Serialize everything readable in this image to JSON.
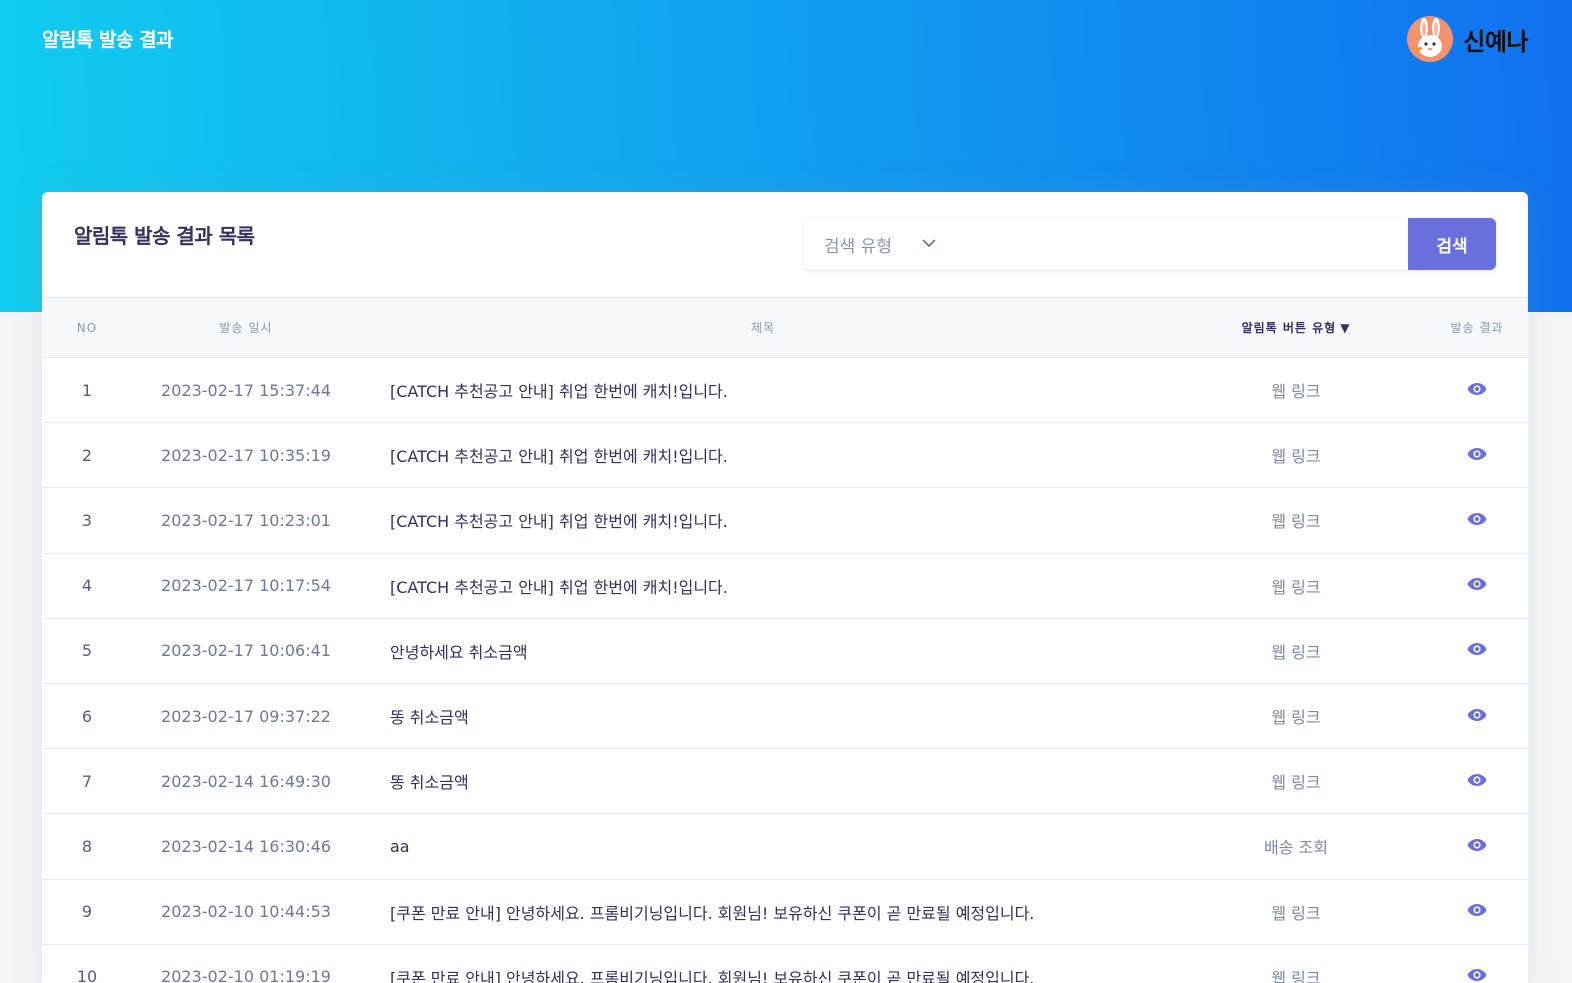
{
  "header": {
    "brand": "알림톡 발송 결과",
    "user_name": "신예나"
  },
  "card": {
    "title": "알림톡 발송 결과 목록",
    "search": {
      "select_placeholder": "검색 유형",
      "button_label": "검색"
    }
  },
  "table": {
    "columns": {
      "no": "NO",
      "date": "발송 일시",
      "subject": "제목",
      "button_type": "알림톡 버튼 유형",
      "result": "발송 결과"
    },
    "rows": [
      {
        "no": "1",
        "date": "2023-02-17 15:37:44",
        "subject": "[CATCH 추천공고 안내] 취업 한번에 캐치!입니다.",
        "button_type": "웹 링크"
      },
      {
        "no": "2",
        "date": "2023-02-17 10:35:19",
        "subject": "[CATCH 추천공고 안내] 취업 한번에 캐치!입니다.",
        "button_type": "웹 링크"
      },
      {
        "no": "3",
        "date": "2023-02-17 10:23:01",
        "subject": "[CATCH 추천공고 안내] 취업 한번에 캐치!입니다.",
        "button_type": "웹 링크"
      },
      {
        "no": "4",
        "date": "2023-02-17 10:17:54",
        "subject": "[CATCH 추천공고 안내] 취업 한번에 캐치!입니다.",
        "button_type": "웹 링크"
      },
      {
        "no": "5",
        "date": "2023-02-17 10:06:41",
        "subject": "안녕하세요 취소금액",
        "button_type": "웹 링크"
      },
      {
        "no": "6",
        "date": "2023-02-17 09:37:22",
        "subject": "똥 취소금액",
        "button_type": "웹 링크"
      },
      {
        "no": "7",
        "date": "2023-02-14 16:49:30",
        "subject": "똥 취소금액",
        "button_type": "웹 링크"
      },
      {
        "no": "8",
        "date": "2023-02-14 16:30:46",
        "subject": "aa",
        "button_type": "배송 조회"
      },
      {
        "no": "9",
        "date": "2023-02-10 10:44:53",
        "subject": "[쿠폰 만료 안내] 안녕하세요. 프롬비기닝입니다. 회원님! 보유하신 쿠폰이 곧 만료될 예정입니다.",
        "button_type": "웹 링크"
      },
      {
        "no": "10",
        "date": "2023-02-10 01:19:19",
        "subject": "[쿠폰 만료 안내] 안녕하세요. 프롬비기닝입니다. 회원님! 보유하신 쿠폰이 곧 만료될 예정입니다.",
        "button_type": "웹 링크"
      }
    ]
  },
  "icons": {
    "avatar": "rabbit-avatar-icon",
    "select_chevron": "chevron-down-icon",
    "sort": "sort-down-icon",
    "view": "eye-icon"
  },
  "colors": {
    "gradient_start": "#11cdef",
    "gradient_end": "#1171ef",
    "search_button": "#6a6fde",
    "eye_icon": "#6a6fde"
  }
}
